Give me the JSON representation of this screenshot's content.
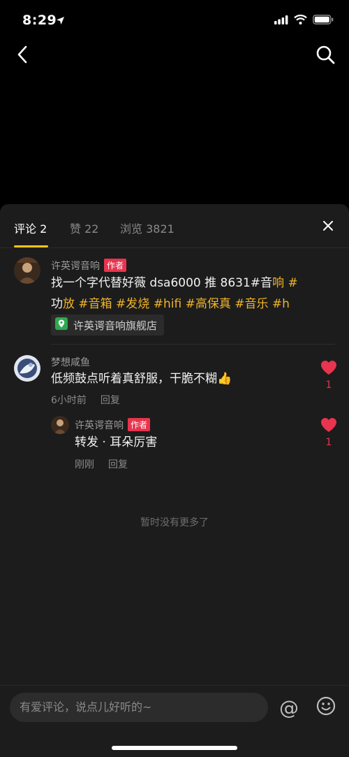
{
  "status": {
    "time": "8:29"
  },
  "tabs": [
    {
      "label": "评论 2"
    },
    {
      "label": "赞 22"
    },
    {
      "label": "浏览 3821"
    }
  ],
  "post": {
    "author": "许英谔音响",
    "author_tag": "作者",
    "text_parts": [
      {
        "t": "找一个字代替好薇 dsa6000 推 8631#音",
        "hl": false
      },
      {
        "t": "响",
        "hl": true
      },
      {
        "t": " #",
        "hl": true
      },
      {
        "t": "功",
        "hl": false
      },
      {
        "t": "放",
        "hl": true
      },
      {
        "t": " #音",
        "hl": true
      },
      {
        "t": "箱",
        "hl": true
      },
      {
        "t": " #发",
        "hl": true
      },
      {
        "t": "烧",
        "hl": true
      },
      {
        "t": " #hifi #高",
        "hl": true
      },
      {
        "t": "保真",
        "hl": true
      },
      {
        "t": " #音",
        "hl": true
      },
      {
        "t": "乐",
        "hl": true
      },
      {
        "t": " #h",
        "hl": true
      }
    ],
    "store_label": "许英谔音响旗舰店"
  },
  "comments": [
    {
      "name": "梦想咸鱼",
      "text": "低频鼓点听着真舒服，干脆不糊👍",
      "time": "6小时前",
      "reply_label": "回复",
      "likes": "1"
    }
  ],
  "reply": {
    "name": "许英谔音响",
    "author_tag": "作者",
    "text": "转发 · 耳朵厉害",
    "time": "刚刚",
    "reply_label": "回复",
    "likes": "1"
  },
  "no_more_text": "暂时没有更多了",
  "input": {
    "placeholder": "有爱评论，说点儿好听的~",
    "at_symbol": "@"
  },
  "colors": {
    "accent": "#f5c518",
    "hashtag": "#f0b429",
    "like_red": "#e8344e",
    "sheet_bg": "#1c1c1c"
  }
}
